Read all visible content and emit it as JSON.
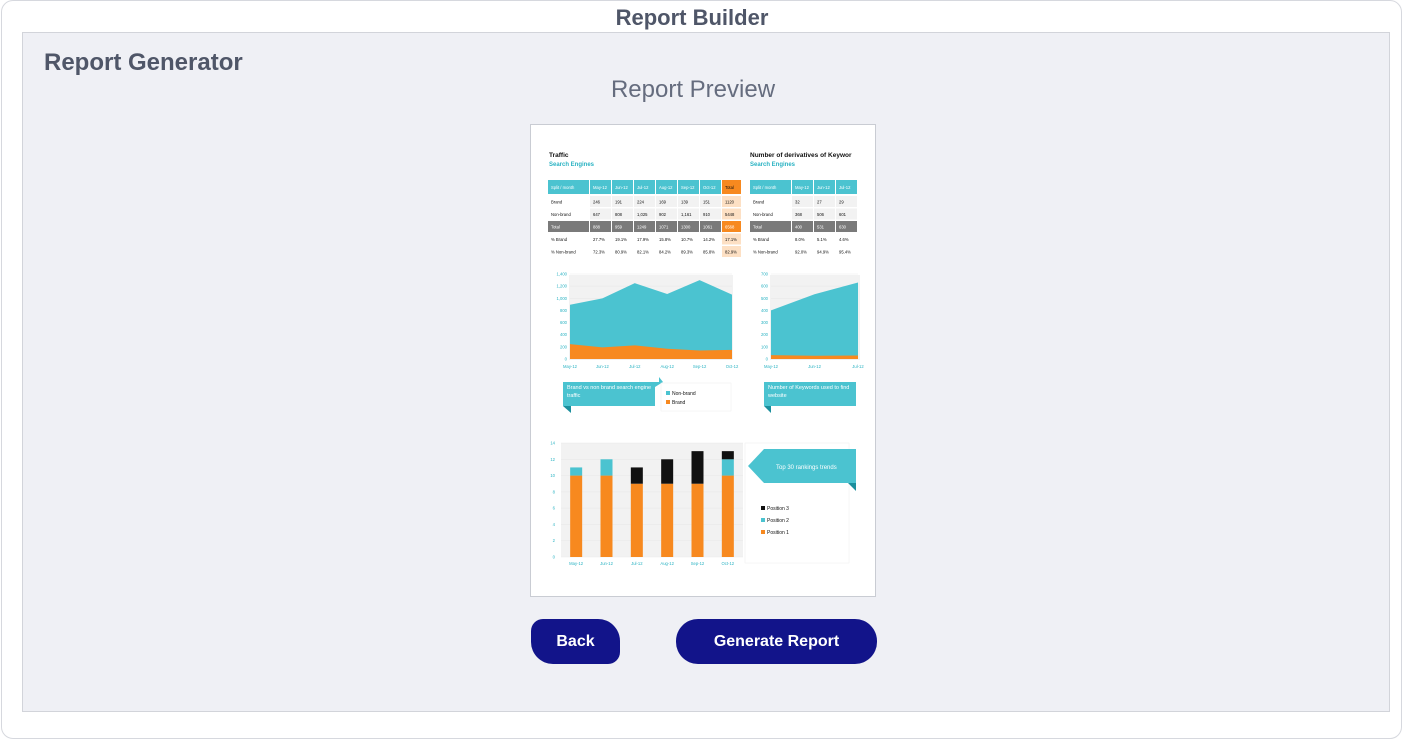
{
  "app": {
    "title": "Report Builder"
  },
  "panel": {
    "title": "Report Generator",
    "preview_title": "Report Preview"
  },
  "buttons": {
    "back": "Back",
    "generate": "Generate Report"
  },
  "colors": {
    "button": "#12148a",
    "teal": "#4bc3d0",
    "orange": "#f7891f",
    "black": "#111111",
    "panel_bg": "#eff0f5"
  },
  "preview": {
    "traffic": {
      "title": "Traffic",
      "subtitle": "Search Engines",
      "headers": [
        "Split / month",
        "May-12",
        "Jun-12",
        "Jul-12",
        "Aug-12",
        "Sep-12",
        "Oct-12",
        "Total"
      ],
      "rows": [
        [
          "Brand",
          "246",
          "191",
          "224",
          "169",
          "139",
          "151",
          "1120"
        ],
        [
          "Non-brand",
          "647",
          "808",
          "1,025",
          "902",
          "1,161",
          "910",
          "5448"
        ],
        [
          "Total",
          "888",
          "959",
          "1249",
          "1071",
          "1300",
          "1061",
          "6568"
        ],
        [
          "% Brand",
          "27.7%",
          "19.1%",
          "17.9%",
          "15.8%",
          "10.7%",
          "14.2%",
          "17.1%"
        ],
        [
          "% Non-brand",
          "72.3%",
          "80.9%",
          "82.1%",
          "84.2%",
          "89.3%",
          "85.8%",
          "82.9%"
        ]
      ]
    },
    "keywords": {
      "title": "Number of derivatives of Keywor",
      "subtitle": "Search Engines",
      "headers": [
        "Split / month",
        "May-12",
        "Jun-12",
        "Jul-12"
      ],
      "rows": [
        [
          "Brand",
          "32",
          "27",
          "29"
        ],
        [
          "Non-brand",
          "368",
          "506",
          "601"
        ],
        [
          "Total",
          "400",
          "531",
          "630"
        ],
        [
          "% Brand",
          "8.0%",
          "5.1%",
          "4.6%"
        ],
        [
          "% Non-brand",
          "92.0%",
          "94.9%",
          "95.4%"
        ]
      ]
    },
    "area_chart_1": {
      "yticks": [
        "1,400",
        "1,200",
        "1,000",
        "800",
        "600",
        "400",
        "200",
        "0"
      ],
      "xticks": [
        "May-12",
        "Jun-12",
        "Jul-12",
        "Aug-12",
        "Sep-12",
        "Oct-12"
      ],
      "callout": "Brand vs non brand search engine traffic",
      "legend": [
        "Non-brand",
        "Brand"
      ]
    },
    "area_chart_2": {
      "yticks": [
        "700",
        "600",
        "500",
        "400",
        "300",
        "200",
        "100",
        "0"
      ],
      "xticks": [
        "May-12",
        "Jun-12",
        "Jul-12"
      ],
      "callout": "Number of Keywords used to find website"
    },
    "bar_chart": {
      "yticks": [
        "14",
        "12",
        "10",
        "8",
        "6",
        "4",
        "2",
        "0"
      ],
      "xticks": [
        "May-12",
        "Jun-12",
        "Jul-12",
        "Aug-12",
        "Sep-12",
        "Oct-12"
      ],
      "callout": "Top 30 rankings trends",
      "legend": [
        "Position 3",
        "Position 2",
        "Position 1"
      ]
    }
  },
  "chart_data": [
    {
      "type": "table",
      "title": "Traffic",
      "subtitle": "Search Engines",
      "columns": [
        "Split / month",
        "May-12",
        "Jun-12",
        "Jul-12",
        "Aug-12",
        "Sep-12",
        "Oct-12",
        "Total"
      ]
    },
    {
      "type": "area",
      "categories": [
        "May-12",
        "Jun-12",
        "Jul-12",
        "Aug-12",
        "Sep-12",
        "Oct-12"
      ],
      "series": [
        {
          "name": "Brand",
          "values": [
            246,
            191,
            224,
            169,
            139,
            151
          ]
        },
        {
          "name": "Non-brand",
          "values": [
            647,
            808,
            1025,
            902,
            1161,
            910
          ]
        }
      ],
      "ylim": [
        0,
        1400
      ],
      "stacked": true
    },
    {
      "type": "area",
      "categories": [
        "May-12",
        "Jun-12",
        "Jul-12"
      ],
      "series": [
        {
          "name": "Brand",
          "values": [
            32,
            27,
            29
          ]
        },
        {
          "name": "Non-brand",
          "values": [
            368,
            506,
            601
          ]
        }
      ],
      "ylim": [
        0,
        700
      ],
      "stacked": true
    },
    {
      "type": "bar",
      "stacked": true,
      "categories": [
        "May-12",
        "Jun-12",
        "Jul-12",
        "Aug-12",
        "Sep-12",
        "Oct-12"
      ],
      "series": [
        {
          "name": "Position 1",
          "values": [
            10,
            10,
            9,
            9,
            9,
            10
          ]
        },
        {
          "name": "Position 2",
          "values": [
            1,
            2,
            0,
            0,
            0,
            2
          ]
        },
        {
          "name": "Position 3",
          "values": [
            0,
            0,
            2,
            3,
            4,
            1
          ]
        }
      ],
      "ylim": [
        0,
        14
      ]
    }
  ]
}
